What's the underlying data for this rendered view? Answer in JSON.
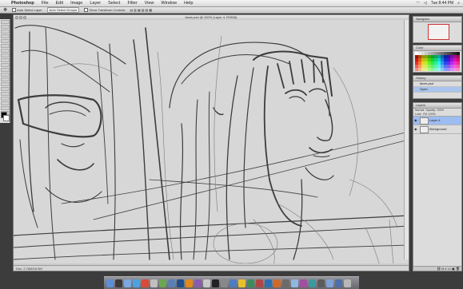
{
  "menubar": {
    "apple": "",
    "items": [
      "Photoshop",
      "File",
      "Edit",
      "Image",
      "Layer",
      "Select",
      "Filter",
      "View",
      "Window",
      "Help"
    ],
    "clock": "Tue 8:44 PM"
  },
  "options_bar": {
    "auto_select": "Auto Select Layer",
    "auto_select_group": "Auto Select Groups",
    "show_transform": "Show Transform Controls"
  },
  "document": {
    "title": "faces.psd @ 100% (Layer 4, RGB/8)",
    "status": "Doc: 2.76M/16.9M"
  },
  "panels": {
    "navigator_tab": "Navigator",
    "color_tab": "Color",
    "history_tab": "History",
    "history_items": [
      "faces.psd",
      "Open"
    ],
    "layers_tab": "Layers",
    "layer_opts": "Normal  Opacity: 100%\nLock:  Fill: 100%",
    "layers": [
      {
        "name": "Layer 4",
        "selected": true
      },
      {
        "name": "Background",
        "selected": false
      }
    ]
  },
  "colors": {
    "accent": "#3b74d9",
    "selection": "#9dbcf0",
    "canvas": "#d7d7d7"
  },
  "dock_icons": [
    "finder-icon",
    "dashboard-icon",
    "mail-icon",
    "safari-icon",
    "ical-icon",
    "addressbook-icon",
    "itunes-icon",
    "iphoto-icon",
    "photoshop-icon",
    "illustrator-icon",
    "bridge-icon",
    "preview-icon",
    "terminal-icon",
    "system-prefs-icon",
    "app-icon",
    "app-icon",
    "app-icon",
    "app-icon",
    "app-icon",
    "app-icon",
    "app-icon",
    "app-icon",
    "app-icon",
    "app-icon",
    "app-icon",
    "folder-icon",
    "downloads-icon",
    "trash-icon"
  ]
}
